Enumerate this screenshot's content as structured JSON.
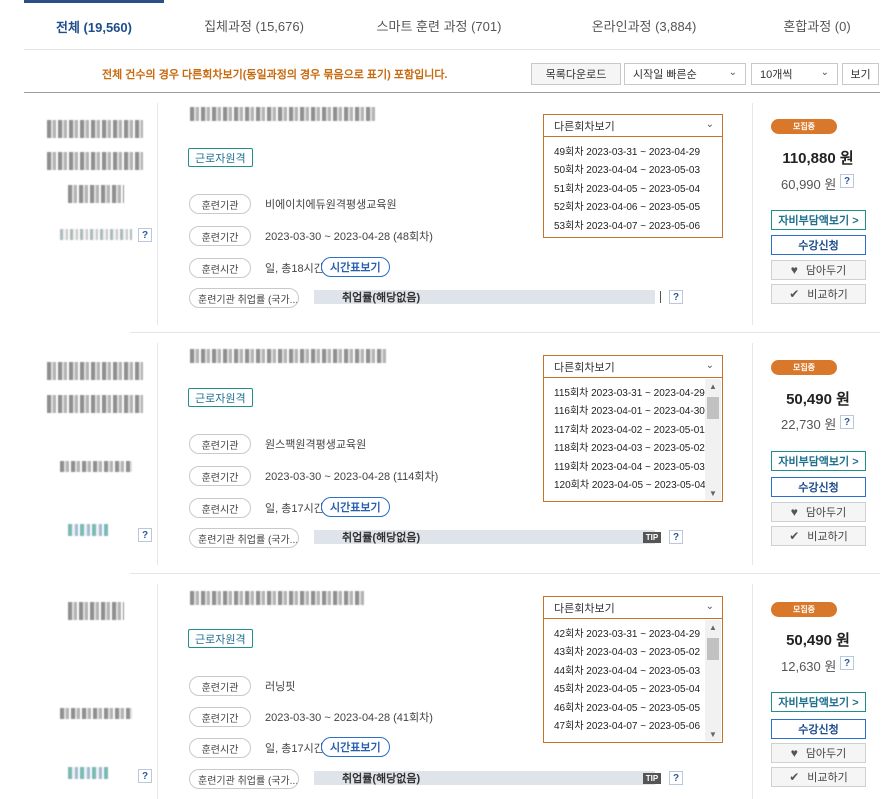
{
  "tabs": [
    {
      "label": "전체 (19,560)",
      "active": true
    },
    {
      "label": "집체과정 (15,676)",
      "active": false
    },
    {
      "label": "스마트 훈련 과정 (701)",
      "active": false
    },
    {
      "label": "온라인과정 (3,884)",
      "active": false
    },
    {
      "label": "혼합과정 (0)",
      "active": false
    }
  ],
  "toolbar": {
    "notice": "전체 건수의 경우 다른회차보기(동일과정의 경우 묶음으로 표기) 포함입니다.",
    "download_label": "목록다운로드",
    "sort_value": "시작일 빠른순",
    "count_value": "10개씩",
    "view_label": "보기"
  },
  "labels": {
    "type_badge": "근로자원격",
    "institution": "훈련기관",
    "period": "훈련기간",
    "hours": "훈련시간",
    "employment": "훈련기관 취업률 (국가...",
    "schedule_btn": "시간표보기",
    "other_sessions": "다른회차보기",
    "status": "모집중",
    "self_pay_btn": "자비부담액보기 >",
    "apply_btn": "수강신청",
    "wishlist_btn": "담아두기",
    "compare_btn": "비교하기",
    "qmark": "?",
    "tip": "TIP"
  },
  "courses": [
    {
      "institution": "비에이치에듀원격평생교육원",
      "period": "2023-03-30 ~ 2023-04-28 (48회차)",
      "hours": "일, 총18시간",
      "employment_rate": "취업률(해당없음)",
      "price": "110,880 원",
      "self_price": "60,990 원",
      "sessions": [
        "49회차 2023-03-31 ~ 2023-04-29",
        "50회차 2023-04-04 ~ 2023-05-03",
        "51회차 2023-04-05 ~ 2023-05-04",
        "52회차 2023-04-06 ~ 2023-05-05",
        "53회차 2023-04-07 ~ 2023-05-06"
      ]
    },
    {
      "institution": "원스팩원격평생교육원",
      "period": "2023-03-30 ~ 2023-04-28 (114회차)",
      "hours": "일, 총17시간",
      "employment_rate": "취업률(해당없음)",
      "price": "50,490 원",
      "self_price": "22,730 원",
      "sessions": [
        "115회차 2023-03-31 ~ 2023-04-29",
        "116회차 2023-04-01 ~ 2023-04-30",
        "117회차 2023-04-02 ~ 2023-05-01",
        "118회차 2023-04-03 ~ 2023-05-02",
        "119회차 2023-04-04 ~ 2023-05-03",
        "120회차 2023-04-05 ~ 2023-05-04"
      ]
    },
    {
      "institution": "러닝핏",
      "period": "2023-03-30 ~ 2023-04-28 (41회차)",
      "hours": "일, 총17시간",
      "employment_rate": "취업률(해당없음)",
      "price": "50,490 원",
      "self_price": "12,630 원",
      "sessions": [
        "42회차 2023-03-31 ~ 2023-04-29",
        "43회차 2023-04-03 ~ 2023-05-02",
        "44회차 2023-04-04 ~ 2023-05-03",
        "45회차 2023-04-05 ~ 2023-05-04",
        "46회차 2023-04-05 ~ 2023-05-05",
        "47회차 2023-04-07 ~ 2023-05-06"
      ]
    }
  ],
  "colors": {
    "accent_blue": "#1e4d8c",
    "status_orange": "#d9782a",
    "teal": "#1f8f8a"
  },
  "icons": {
    "heart": "heart-icon",
    "check": "check-icon",
    "chevron": "chevron-down-icon"
  }
}
